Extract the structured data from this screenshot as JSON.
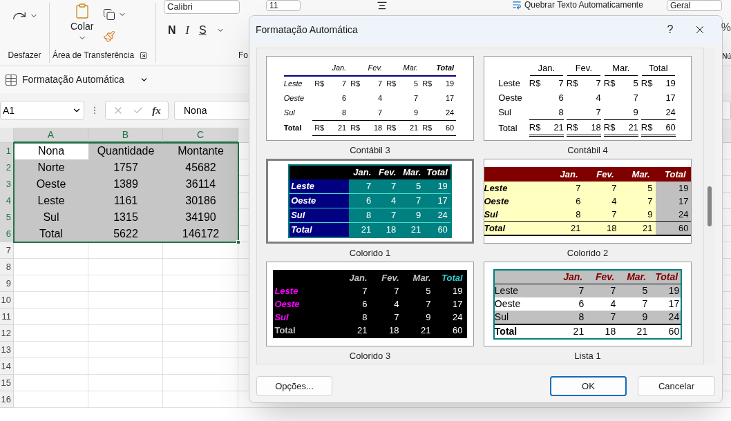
{
  "ribbon": {
    "undo_group": {
      "label": "Desfazer"
    },
    "clipboard_group": {
      "paste": "Colar",
      "label": "Área de Transferência"
    },
    "font_group": {
      "font": "Calibri",
      "size": "11",
      "bold": "N",
      "italic": "I",
      "underline": "S",
      "label": "Fo"
    },
    "wrap_text": "Quebrar Texto Automaticamente",
    "number_format": "Geral",
    "percent": "%",
    "number_group_label": "Nú"
  },
  "quick_toolbar": {
    "autoformat": "Formatação Automática"
  },
  "formula_bar": {
    "name_box": "A1",
    "fx": "fx",
    "value": "Nona"
  },
  "sheet": {
    "columns": [
      "A",
      "B",
      "C"
    ],
    "row_numbers": [
      "1",
      "2",
      "3",
      "4",
      "5",
      "6",
      "7",
      "8",
      "9",
      "10",
      "11",
      "12",
      "13",
      "14",
      "15",
      "16"
    ],
    "rows": [
      [
        "Nona",
        "Quantidade",
        "Montante"
      ],
      [
        "Norte",
        "1757",
        "45682"
      ],
      [
        "Oeste",
        "1389",
        "36114"
      ],
      [
        "Leste",
        "1161",
        "30186"
      ],
      [
        "Sul",
        "1315",
        "34190"
      ],
      [
        "Total",
        "5622",
        "146172"
      ]
    ]
  },
  "dialog": {
    "title": "Formatação Automática",
    "help": "?",
    "formats": [
      {
        "name": "Contábil 3",
        "selected": false,
        "kind": "contabil3",
        "columns": [
          "Jan.",
          "Fev.",
          "Mar.",
          "Total"
        ],
        "rows": [
          {
            "label": "Leste",
            "cells": [
              {
                "currency": "R$",
                "value": "7"
              },
              {
                "currency": "R$",
                "value": "7"
              },
              {
                "currency": "R$",
                "value": "5"
              },
              {
                "currency": "R$",
                "value": "19"
              }
            ]
          },
          {
            "label": "Oeste",
            "cells": [
              {
                "value": "6"
              },
              {
                "value": "4"
              },
              {
                "value": "7"
              },
              {
                "value": "17"
              }
            ]
          },
          {
            "label": "Sul",
            "cells": [
              {
                "value": "8"
              },
              {
                "value": "7"
              },
              {
                "value": "9"
              },
              {
                "value": "24"
              }
            ]
          },
          {
            "label": "Total",
            "cells": [
              {
                "currency": "R$",
                "value": "21"
              },
              {
                "currency": "R$",
                "value": "18"
              },
              {
                "currency": "R$",
                "value": "21"
              },
              {
                "currency": "R$",
                "value": "60"
              }
            ]
          }
        ]
      },
      {
        "name": "Contábil 4",
        "selected": false,
        "kind": "contabil4",
        "columns": [
          "Jan.",
          "Fev.",
          "Mar.",
          "Total"
        ],
        "rows": [
          {
            "label": "Leste",
            "cells": [
              {
                "currency": "R$",
                "value": "7"
              },
              {
                "currency": "R$",
                "value": "7"
              },
              {
                "currency": "R$",
                "value": "5"
              },
              {
                "currency": "R$",
                "value": "19"
              }
            ]
          },
          {
            "label": "Oeste",
            "cells": [
              {
                "value": "6"
              },
              {
                "value": "4"
              },
              {
                "value": "7"
              },
              {
                "value": "17"
              }
            ]
          },
          {
            "label": "Sul",
            "cells": [
              {
                "value": "8"
              },
              {
                "value": "7"
              },
              {
                "value": "9"
              },
              {
                "value": "24"
              }
            ]
          },
          {
            "label": "Total",
            "cells": [
              {
                "currency": "R$",
                "value": "21"
              },
              {
                "currency": "R$",
                "value": "18"
              },
              {
                "currency": "R$",
                "value": "21"
              },
              {
                "currency": "R$",
                "value": "60"
              }
            ]
          }
        ]
      },
      {
        "name": "Colorido 1",
        "selected": true,
        "kind": "colorido1",
        "columns": [
          "Jan.",
          "Fev.",
          "Mar.",
          "Total"
        ],
        "rows": [
          {
            "label": "Leste",
            "cells": [
              {
                "value": "7"
              },
              {
                "value": "7"
              },
              {
                "value": "5"
              },
              {
                "value": "19"
              }
            ]
          },
          {
            "label": "Oeste",
            "cells": [
              {
                "value": "6"
              },
              {
                "value": "4"
              },
              {
                "value": "7"
              },
              {
                "value": "17"
              }
            ]
          },
          {
            "label": "Sul",
            "cells": [
              {
                "value": "8"
              },
              {
                "value": "7"
              },
              {
                "value": "9"
              },
              {
                "value": "24"
              }
            ]
          },
          {
            "label": "Total",
            "cells": [
              {
                "value": "21"
              },
              {
                "value": "18"
              },
              {
                "value": "21"
              },
              {
                "value": "60"
              }
            ]
          }
        ]
      },
      {
        "name": "Colorido 2",
        "selected": false,
        "kind": "colorido2",
        "columns": [
          "Jan.",
          "Fev.",
          "Mar.",
          "Total"
        ],
        "rows": [
          {
            "label": "Leste",
            "cells": [
              {
                "value": "7"
              },
              {
                "value": "7"
              },
              {
                "value": "5"
              },
              {
                "value": "19"
              }
            ]
          },
          {
            "label": "Oeste",
            "cells": [
              {
                "value": "6"
              },
              {
                "value": "4"
              },
              {
                "value": "7"
              },
              {
                "value": "17"
              }
            ]
          },
          {
            "label": "Sul",
            "cells": [
              {
                "value": "8"
              },
              {
                "value": "7"
              },
              {
                "value": "9"
              },
              {
                "value": "24"
              }
            ]
          },
          {
            "label": "Total",
            "cells": [
              {
                "value": "21"
              },
              {
                "value": "18"
              },
              {
                "value": "21"
              },
              {
                "value": "60"
              }
            ]
          }
        ]
      },
      {
        "name": "Colorido 3",
        "selected": false,
        "kind": "colorido3",
        "columns": [
          "Jan.",
          "Fev.",
          "Mar.",
          "Total"
        ],
        "rows": [
          {
            "label": "Leste",
            "cells": [
              {
                "value": "7"
              },
              {
                "value": "7"
              },
              {
                "value": "5"
              },
              {
                "value": "19"
              }
            ]
          },
          {
            "label": "Oeste",
            "cells": [
              {
                "value": "6"
              },
              {
                "value": "4"
              },
              {
                "value": "7"
              },
              {
                "value": "17"
              }
            ]
          },
          {
            "label": "Sul",
            "cells": [
              {
                "value": "8"
              },
              {
                "value": "7"
              },
              {
                "value": "9"
              },
              {
                "value": "24"
              }
            ]
          },
          {
            "label": "Total",
            "cells": [
              {
                "value": "21"
              },
              {
                "value": "18"
              },
              {
                "value": "21"
              },
              {
                "value": "60"
              }
            ]
          }
        ]
      },
      {
        "name": "Lista 1",
        "selected": false,
        "kind": "lista1",
        "columns": [
          "Jan.",
          "Fev.",
          "Mar.",
          "Total"
        ],
        "rows": [
          {
            "label": "Leste",
            "cells": [
              {
                "value": "7"
              },
              {
                "value": "7"
              },
              {
                "value": "5"
              },
              {
                "value": "19"
              }
            ]
          },
          {
            "label": "Oeste",
            "cells": [
              {
                "value": "6"
              },
              {
                "value": "4"
              },
              {
                "value": "7"
              },
              {
                "value": "17"
              }
            ]
          },
          {
            "label": "Sul",
            "cells": [
              {
                "value": "8"
              },
              {
                "value": "7"
              },
              {
                "value": "9"
              },
              {
                "value": "24"
              }
            ]
          },
          {
            "label": "Total",
            "cells": [
              {
                "value": "21"
              },
              {
                "value": "18"
              },
              {
                "value": "21"
              },
              {
                "value": "60"
              }
            ]
          }
        ]
      }
    ],
    "buttons": {
      "options": "Opções...",
      "ok": "OK",
      "cancel": "Cancelar"
    }
  }
}
